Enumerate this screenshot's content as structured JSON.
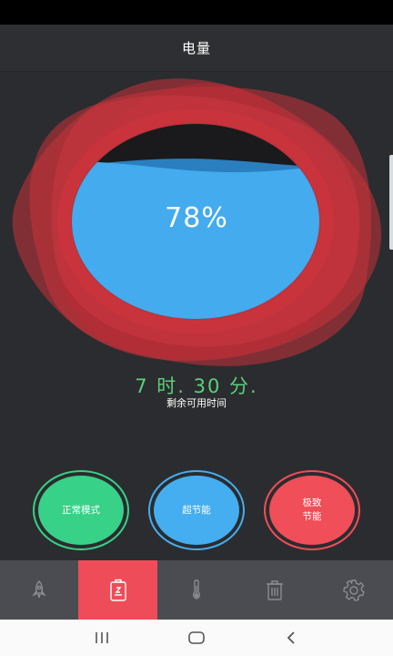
{
  "header": {
    "title": "电量"
  },
  "battery": {
    "percent_text": "78%",
    "level": 0.78
  },
  "remaining": {
    "time_text": "7 时. 30 分.",
    "caption": "剩余可用时间"
  },
  "modes": [
    {
      "label": "正常模式",
      "color": "#38d188"
    },
    {
      "label": "超节能",
      "color": "#45aef0"
    },
    {
      "label": "极致\n节能",
      "color": "#f04e58"
    }
  ],
  "tabs": [
    {
      "icon": "rocket-icon",
      "active": false
    },
    {
      "icon": "battery-icon",
      "active": true
    },
    {
      "icon": "thermometer-icon",
      "active": false
    },
    {
      "icon": "trash-icon",
      "active": false
    },
    {
      "icon": "gear-icon",
      "active": false
    }
  ],
  "colors": {
    "accent": "#ef4c5a",
    "water": "#43abee",
    "text_green": "#5ad17a",
    "background": "#2b2c2f"
  },
  "system_nav": [
    "recents-icon",
    "home-icon",
    "back-icon"
  ]
}
